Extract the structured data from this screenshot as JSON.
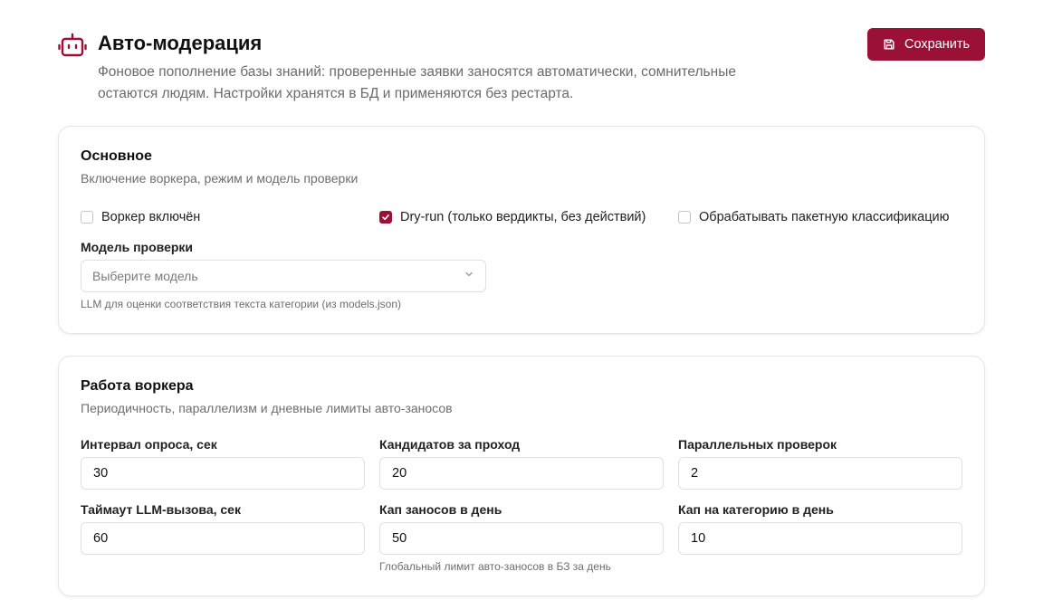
{
  "header": {
    "title": "Авто-модерация",
    "subtitle": "Фоновое пополнение базы знаний: проверенные заявки заносятся автоматически, сомнительные остаются людям. Настройки хранятся в БД и применяются без рестарта.",
    "icon": "robot-icon",
    "save_label": "Сохранить",
    "accent_color": "#9b1036"
  },
  "main_card": {
    "title": "Основное",
    "description": "Включение воркера, режим и модель проверки",
    "checkboxes": [
      {
        "label": "Воркер включён",
        "checked": false
      },
      {
        "label": "Dry-run (только вердикты, без действий)",
        "checked": true
      },
      {
        "label": "Обрабатывать пакетную классификацию",
        "checked": false
      }
    ],
    "model_label": "Модель проверки",
    "model_placeholder": "Выберите модель",
    "model_hint": "LLM для оценки соответствия текста категории (из models.json)"
  },
  "worker_card": {
    "title": "Работа воркера",
    "description": "Периодичность, параллелизм и дневные лимиты авто-заносов",
    "fields": [
      {
        "label": "Интервал опроса, сек",
        "value": "30"
      },
      {
        "label": "Кандидатов за проход",
        "value": "20"
      },
      {
        "label": "Параллельных проверок",
        "value": "2"
      },
      {
        "label": "Таймаут LLM-вызова, сек",
        "value": "60"
      },
      {
        "label": "Кап заносов в день",
        "value": "50"
      },
      {
        "label": "Кап на категорию в день",
        "value": "10"
      }
    ],
    "daily_cap_hint": "Глобальный лимит авто-заносов в БЗ за день"
  }
}
